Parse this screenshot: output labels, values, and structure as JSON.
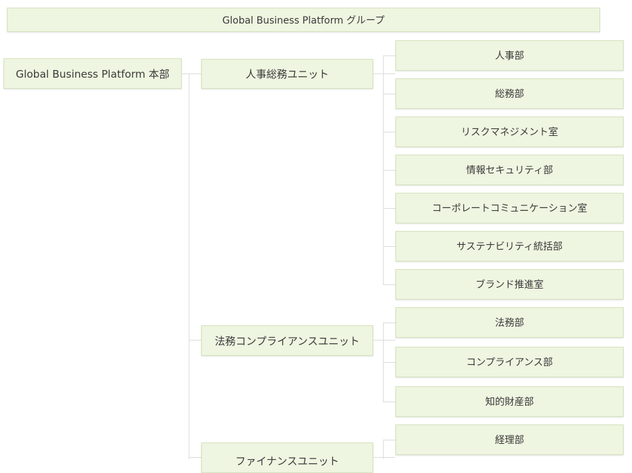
{
  "group": {
    "label": "Global Business Platform グループ"
  },
  "headquarters": {
    "label": "Global Business Platform 本部"
  },
  "units": [
    {
      "label": "人事総務ユニット",
      "departments": [
        "人事部",
        "総務部",
        "リスクマネジメント室",
        "情報セキュリティ部",
        "コーポレートコミュニケーション室",
        "サステナビリティ統括部",
        "ブランド推進室"
      ]
    },
    {
      "label": "法務コンプライアンスユニット",
      "departments": [
        "法務部",
        "コンプライアンス部",
        "知的財産部"
      ]
    },
    {
      "label": "ファイナンスユニット",
      "departments": [
        "経理部"
      ]
    }
  ],
  "colors": {
    "box_fill": "#eef5e0",
    "box_border": "#d4e3bd",
    "connector": "#dcdcdc"
  }
}
